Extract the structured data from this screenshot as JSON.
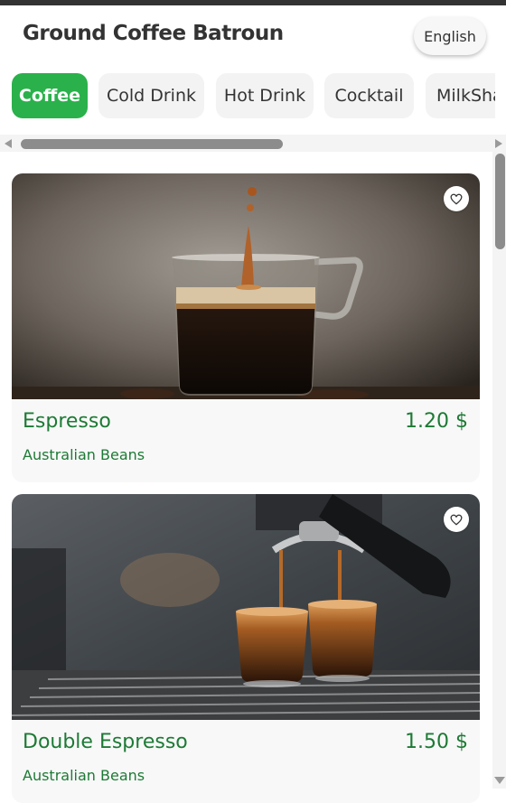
{
  "header": {
    "title": "Ground Coffee Batroun",
    "language": "English"
  },
  "categories": [
    "Coffee",
    "Cold Drink",
    "Hot Drink",
    "Cocktail",
    "MilkShake"
  ],
  "active_category": "Coffee",
  "items": [
    {
      "name": "Espresso",
      "price": "1.20 $",
      "description": "Australian Beans"
    },
    {
      "name": "Double Espresso",
      "price": "1.50 $",
      "description": "Australian Beans"
    }
  ],
  "colors": {
    "accent": "#2ab14b",
    "text_green": "#1d7a35",
    "dark": "#333333"
  },
  "icons": [
    "heart-icon",
    "scroll-arrow-left-icon",
    "scroll-arrow-right-icon",
    "scroll-arrow-down-icon"
  ]
}
